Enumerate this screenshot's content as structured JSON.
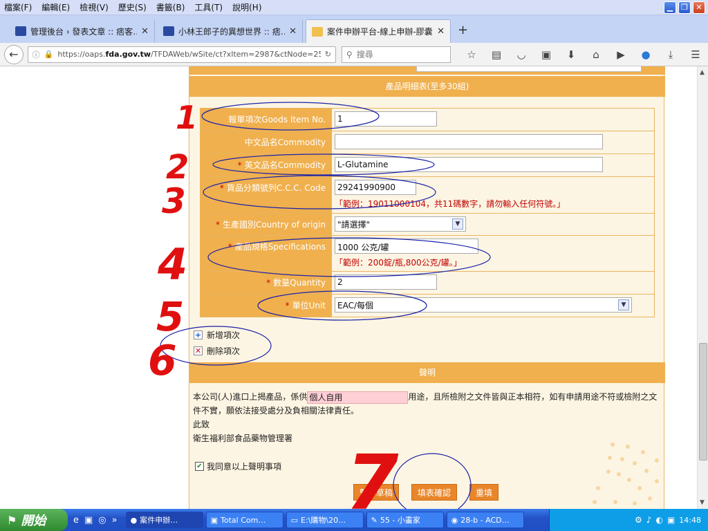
{
  "menubar": {
    "items": [
      "檔案(F)",
      "編輯(E)",
      "檢視(V)",
      "歷史(S)",
      "書籤(B)",
      "工具(T)",
      "說明(H)"
    ]
  },
  "tabs": [
    {
      "title": "管理後台 › 發表文章 :: 痞客…",
      "color": "#2a4aa0"
    },
    {
      "title": "小林王郎子的異想世界 :: 痞…",
      "color": "#2a4aa0"
    },
    {
      "title": "案件申辦平台-線上申辦-膠囊…",
      "color": "#f0c050",
      "active": true
    }
  ],
  "navbar": {
    "url_prefix": "https://oaps.",
    "url_domain": "fda.gov.tw",
    "url_rest": "/TFDAWeb/wSite/ct?xItem=2987&ctNode=25:",
    "search_placeholder": "搜尋"
  },
  "section_titles": {
    "product_details": "產品明細表(至多30組)",
    "declaration": "聲明"
  },
  "form": {
    "rows": [
      {
        "label": "報單項次Goods Item No.",
        "required": false,
        "value": "1",
        "hint": ""
      },
      {
        "label": "中文品名Commodity",
        "required": false,
        "value": "",
        "hint": ""
      },
      {
        "label": "英文品名Commodity",
        "required": true,
        "value": "L-Glutamine",
        "hint": ""
      },
      {
        "label": "貨品分類號列C.C.C. Code",
        "required": true,
        "value": "29241990900",
        "hint": "「範例：19011000104，共11碼數字，請勿輸入任何符號。」"
      },
      {
        "label": "生產國別Country of origin",
        "required": true,
        "value": "\"請選擇\"",
        "hint": ""
      },
      {
        "label": "產品規格Specifications",
        "required": true,
        "value": "1000 公克/罐",
        "hint": "「範例：200錠/瓶,800公克/罐。」"
      },
      {
        "label": "數量Quantity",
        "required": true,
        "value": "2",
        "hint": ""
      },
      {
        "label": "單位Unit",
        "required": true,
        "value": "EAC/每個",
        "hint": ""
      }
    ],
    "required_mark": "*"
  },
  "item_actions": {
    "add": "新增項次",
    "delete": "刪除項次"
  },
  "declaration": {
    "text_before": "本公司(人)進口上揭產品，係供",
    "purpose": "個人自用",
    "text_after": "用途，且所檢附之文件皆與正本相符，如有申請用途不符或檢附之文件不實，願依法接受處分及負相關法律責任。",
    "salutation": "此致",
    "recipient": "衛生福利部食品藥物管理署",
    "agree_label": "我同意以上聲明事項"
  },
  "buttons": {
    "save_draft": "暫存草稿",
    "confirm": "填表確認",
    "reset": "重填"
  },
  "annotations": [
    "1",
    "2",
    "3",
    "4",
    "5",
    "6",
    "7"
  ],
  "taskbar": {
    "start": "開始",
    "tasks": [
      "案件申辦…",
      "Total Com…",
      "E:\\購物\\20…",
      "55 - 小畫家",
      "28-b - ACD…"
    ],
    "clock": "14:48"
  },
  "colors": {
    "header_orange": "#f0b04e",
    "button_orange": "#e8862a",
    "hint_red": "#c00000",
    "annotation_red": "#e01010",
    "annotation_blue": "#1a22a8"
  }
}
